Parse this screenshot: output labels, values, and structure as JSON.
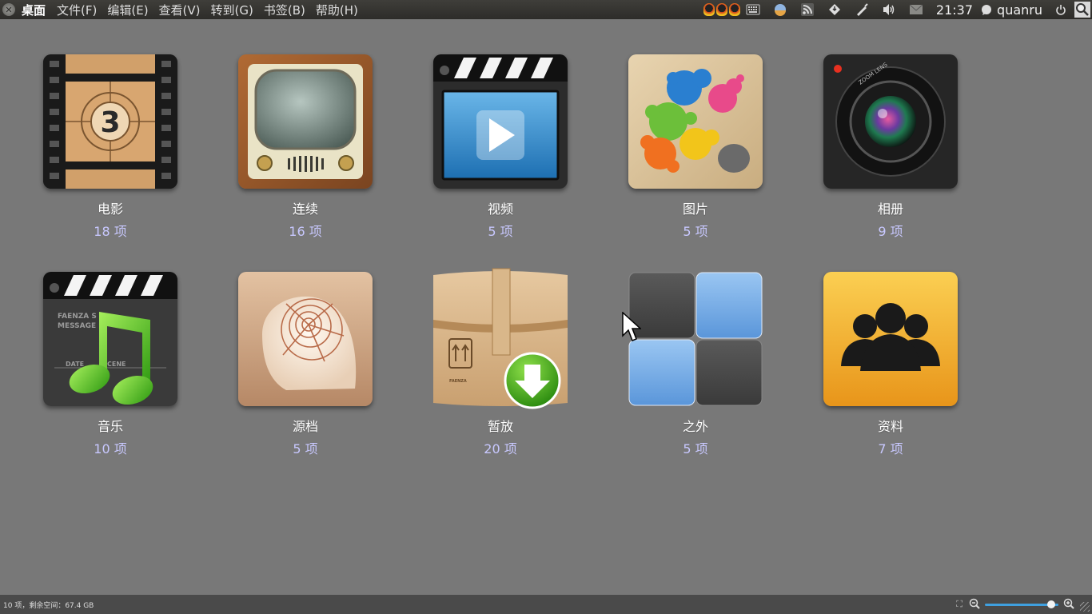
{
  "window": {
    "title": "桌面",
    "menu": [
      "文件(F)",
      "编辑(E)",
      "查看(V)",
      "转到(G)",
      "书签(B)",
      "帮助(H)"
    ]
  },
  "tray": {
    "icons": [
      "qq-penguin-icon",
      "qq-penguin-icon",
      "qq-penguin-icon",
      "keyboard-icon",
      "weather-icon",
      "rss-icon",
      "network-icon",
      "pen-icon",
      "volume-icon",
      "mail-icon"
    ],
    "clock": "21:37",
    "user": "quanru"
  },
  "folders": [
    {
      "name": "电影",
      "count": "18 项",
      "icon": "film-reel-icon"
    },
    {
      "name": "连续",
      "count": "16 项",
      "icon": "tv-icon"
    },
    {
      "name": "视频",
      "count": "5 项",
      "icon": "video-clapper-icon"
    },
    {
      "name": "图片",
      "count": "5 项",
      "icon": "paint-palette-icon"
    },
    {
      "name": "相册",
      "count": "9 项",
      "icon": "camera-lens-icon"
    },
    {
      "name": "音乐",
      "count": "10 项",
      "icon": "music-clapper-icon"
    },
    {
      "name": "源档",
      "count": "5 项",
      "icon": "nautilus-shell-icon"
    },
    {
      "name": "暂放",
      "count": "20 项",
      "icon": "download-box-icon"
    },
    {
      "name": "之外",
      "count": "5 项",
      "icon": "grid-tiles-icon"
    },
    {
      "name": "资料",
      "count": "7 项",
      "icon": "people-group-icon"
    }
  ],
  "icon_text": {
    "film_number": "3",
    "clapper_labels": [
      "FAENZA S",
      "MESSAGE",
      "DATE",
      "CENE"
    ],
    "lens_text": "ZOOM LENS",
    "box_brand": "FAENZA"
  },
  "statusbar": {
    "text": "10 项，剩余空间：67.4 GB",
    "zoom_fraction": 0.9
  },
  "colors": {
    "background": "#787878",
    "count_text": "#c8c8ff",
    "accent_blue": "#3fa0e0"
  }
}
